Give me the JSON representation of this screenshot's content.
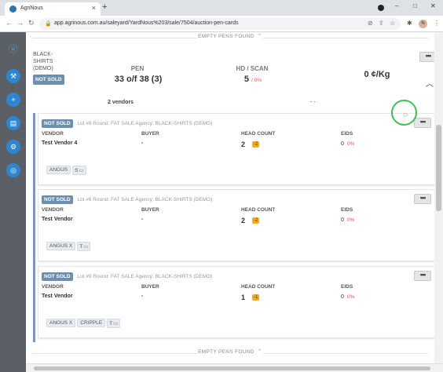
{
  "browser": {
    "tab_title": "AgriNous",
    "tab_close": "×",
    "new_tab": "+",
    "url": "app.agrinous.com.au/saleyard/YardNous%203/sale/7504/auction-pen-cards",
    "avatar_letter": "N",
    "controls": {
      "minimize": "–",
      "maximize": "□",
      "close": "✕"
    }
  },
  "sidebar": {
    "logo": "ⓤ",
    "items": [
      {
        "name": "gavel-icon",
        "glyph": "⚒"
      },
      {
        "name": "add-icon",
        "glyph": "+"
      },
      {
        "name": "id-card-icon",
        "glyph": "▤"
      },
      {
        "name": "cattle-settings-icon",
        "glyph": "⚙"
      },
      {
        "name": "cattle-search-icon",
        "glyph": "◎"
      }
    ]
  },
  "banner_top": "EMPTY PENS FOUND",
  "banner_bottom": "EMPTY PENS FOUND",
  "pen": {
    "vendor_label": "BLACK-SHIRTS (DEMO)",
    "status": "NOT SOLD",
    "pen_label": "PEN",
    "pen_value": "33 o/f 38 (3)",
    "hd_scan_label": "HD / SCAN",
    "hd_scan_value": "5",
    "hd_scan_pct": "/ 0%",
    "price_value": "0 ¢/Kg",
    "vendors_count": "2 vendors",
    "dash": "- -",
    "more": "•••"
  },
  "lots": [
    {
      "status": "NOT SOLD",
      "meta": "Lot #8  Round: FAT SALE  Agency: BLACK-SHIRTS (DEMO)",
      "vendor_label": "VENDOR",
      "buyer_label": "BUYER",
      "head_label": "HEAD COUNT",
      "eids_label": "EIDS",
      "vendor": "Test Vendor 4",
      "buyer": "-",
      "head": "2",
      "head_delta": "-2",
      "eids": "0",
      "eids_pct": "0%",
      "tags": [
        "ANGUS",
        "S"
      ],
      "more": "•••"
    },
    {
      "status": "NOT SOLD",
      "meta": "Lot #6  Round: FAT SALE  Agency: BLACK-SHIRTS (DEMO)",
      "vendor_label": "VENDOR",
      "buyer_label": "BUYER",
      "head_label": "HEAD COUNT",
      "eids_label": "EIDS",
      "vendor": "Test Vendor",
      "buyer": "-",
      "head": "2",
      "head_delta": "-2",
      "eids": "0",
      "eids_pct": "0%",
      "tags": [
        "ANGUS X",
        "T"
      ],
      "more": "•••"
    },
    {
      "status": "NOT SOLD",
      "meta": "Lot #9  Round: FAT SALE  Agency: BLACK-SHIRTS (DEMO)",
      "vendor_label": "VENDOR",
      "buyer_label": "BUYER",
      "head_label": "HEAD COUNT",
      "eids_label": "EIDS",
      "vendor": "Test Vendor",
      "buyer": "-",
      "head": "1",
      "head_delta": "-1",
      "eids": "0",
      "eids_pct": "0%",
      "tags": [
        "ANGUS X",
        "CRIPPLE",
        "T"
      ],
      "more": "•••"
    }
  ],
  "colors": {
    "accent": "#2e86d1",
    "not_sold": "#6c8faf",
    "warning": "#f0ad1e",
    "negative": "#d9534f"
  }
}
